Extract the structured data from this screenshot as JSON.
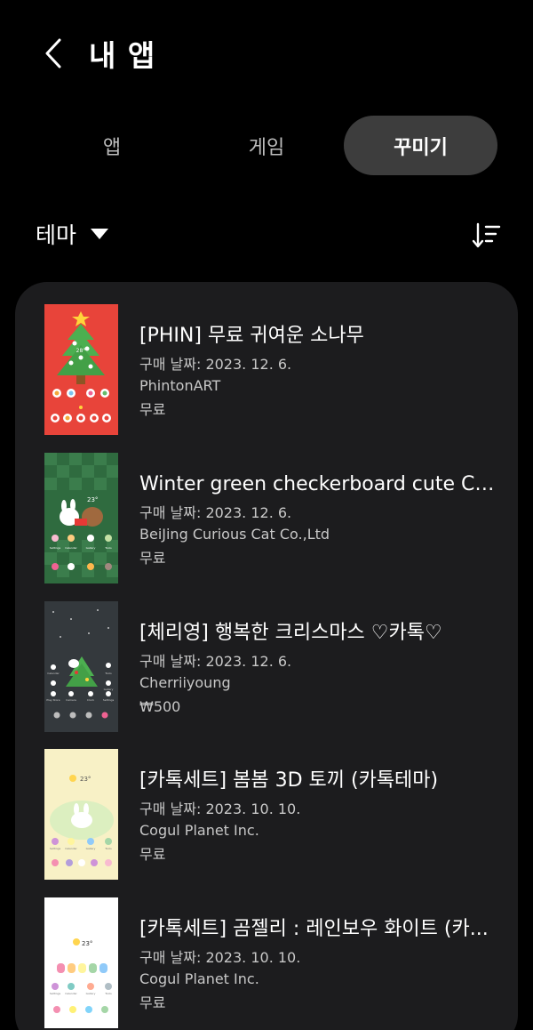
{
  "header": {
    "title": "내 앱",
    "back_icon": "chevron-left-icon"
  },
  "tabs": [
    {
      "label": "앱",
      "selected": false
    },
    {
      "label": "게임",
      "selected": false
    },
    {
      "label": "꾸미기",
      "selected": true
    }
  ],
  "filter": {
    "label": "테마",
    "icon": "caret-down-icon"
  },
  "sort": {
    "icon": "sort-icon"
  },
  "colors": {
    "background": "#000000",
    "card": "#1c1c1e",
    "tab_selected": "#3d3d3d"
  },
  "items": [
    {
      "title": "[PHIN] 무료 귀여운 소나무",
      "date": "구매 날짜: 2023. 12. 6.",
      "developer": "PhintonART",
      "price": "무료"
    },
    {
      "title": "Winter green checkerboard cute Ch...",
      "date": "구매 날짜: 2023. 12. 6.",
      "developer": "BeiJing Curious Cat Co.,Ltd",
      "price": "무료"
    },
    {
      "title": "[체리영] 행복한 크리스마스 ♡카톡♡",
      "date": "구매 날짜: 2023. 12. 6.",
      "developer": "Cherriiyoung",
      "price": "₩500"
    },
    {
      "title": "[카톡세트] 봄봄 3D 토끼 (카톡테마)",
      "date": "구매 날짜: 2023. 10. 10.",
      "developer": "Cogul Planet Inc.",
      "price": "무료"
    },
    {
      "title": "[카톡세트] 곰젤리 : 레인보우 화이트 (카...",
      "date": "구매 날짜: 2023. 10. 10.",
      "developer": "Cogul Planet Inc.",
      "price": "무료"
    }
  ],
  "thumbnails": {
    "item0": {
      "temp": "28°",
      "labels": []
    },
    "item1": {
      "temp": "23°",
      "labels": [
        "Settings",
        "Calendar",
        "Gallery",
        "Tools"
      ]
    },
    "item2": {
      "temp": "",
      "labels": [
        "Calendar",
        "Tools",
        "Gallery",
        "Play Store",
        "Camera",
        "Clock",
        "Settings"
      ]
    },
    "item3": {
      "temp": "23°",
      "labels": [
        "Settings",
        "Calendar",
        "Gallery",
        "Tools"
      ]
    },
    "item4": {
      "temp": "23°",
      "labels": [
        "Settings",
        "Calendar",
        "Gallery",
        "Tools"
      ]
    }
  }
}
